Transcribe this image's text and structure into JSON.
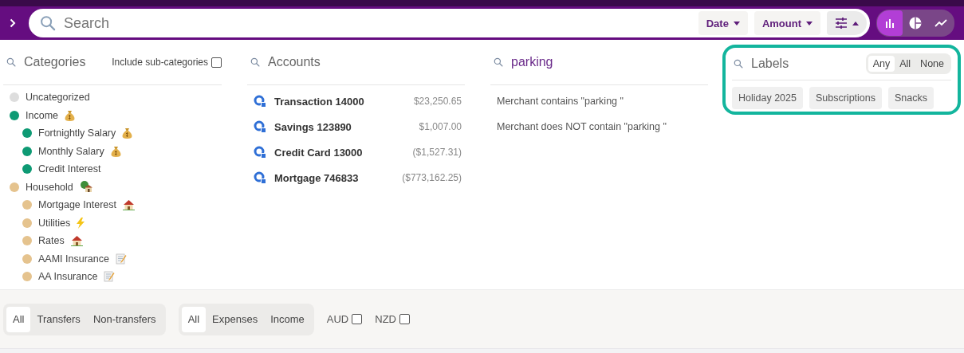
{
  "search": {
    "placeholder": "Search"
  },
  "sort_buttons": [
    {
      "label": "Date",
      "kind": "dropdown"
    },
    {
      "label": "Amount",
      "kind": "dropdown"
    },
    {
      "kind": "filters",
      "expanded": true
    }
  ],
  "chart_toggle": [
    {
      "kind": "bar",
      "selected": true
    },
    {
      "kind": "pie",
      "selected": false
    },
    {
      "kind": "line",
      "selected": false
    }
  ],
  "categories": {
    "title": "Categories",
    "include_sub": {
      "label": "Include sub-categories",
      "checked": false
    },
    "items": [
      {
        "label": "Uncategorized",
        "color": "#dddddd",
        "kind": "plain"
      },
      {
        "label": "Income",
        "color": "#0e9a74",
        "kind": "money",
        "children": [
          {
            "label": "Fortnightly Salary",
            "color": "#0e9a74",
            "kind": "money"
          },
          {
            "label": "Monthly Salary",
            "color": "#0e9a74",
            "kind": "money"
          },
          {
            "label": "Credit Interest",
            "color": "#0e9a74",
            "kind": "plain"
          }
        ]
      },
      {
        "label": "Household",
        "color": "#e5c38e",
        "kind": "treehouse",
        "children": [
          {
            "label": "Mortgage Interest",
            "color": "#e5c38e",
            "kind": "house"
          },
          {
            "label": "Utilities",
            "color": "#e5c38e",
            "kind": "bolt"
          },
          {
            "label": "Rates",
            "color": "#e5c38e",
            "kind": "house"
          },
          {
            "label": "AAMI Insurance",
            "color": "#e5c38e",
            "kind": "memo"
          },
          {
            "label": "AA Insurance",
            "color": "#e5c38e",
            "kind": "memo"
          }
        ]
      }
    ]
  },
  "accounts": {
    "title": "Accounts",
    "items": [
      {
        "name": "Transaction 14000",
        "balance": "$23,250.65"
      },
      {
        "name": "Savings 123890",
        "balance": "$1,007.00"
      },
      {
        "name": "Credit Card 13000",
        "balance": "($1,527.31)"
      },
      {
        "name": "Mortgage 746833",
        "balance": "($773,162.25)"
      }
    ]
  },
  "merchant": {
    "query": "parking",
    "suggestions": [
      "Merchant contains \"parking \"",
      "Merchant does NOT contain \"parking \""
    ]
  },
  "labels": {
    "title": "Labels",
    "match": [
      {
        "label": "Any",
        "selected": true
      },
      {
        "label": "All",
        "selected": false
      },
      {
        "label": "None",
        "selected": false
      }
    ],
    "items": [
      "Holiday 2025",
      "Subscriptions",
      "Snacks"
    ]
  },
  "footer": {
    "transfer_filter": [
      {
        "label": "All",
        "selected": true
      },
      {
        "label": "Transfers",
        "selected": false
      },
      {
        "label": "Non-transfers",
        "selected": false
      }
    ],
    "type_filter": [
      {
        "label": "All",
        "selected": true
      },
      {
        "label": "Expenses",
        "selected": false
      },
      {
        "label": "Income",
        "selected": false
      }
    ],
    "currencies": [
      {
        "label": "AUD",
        "checked": false
      },
      {
        "label": "NZD",
        "checked": false
      }
    ]
  }
}
